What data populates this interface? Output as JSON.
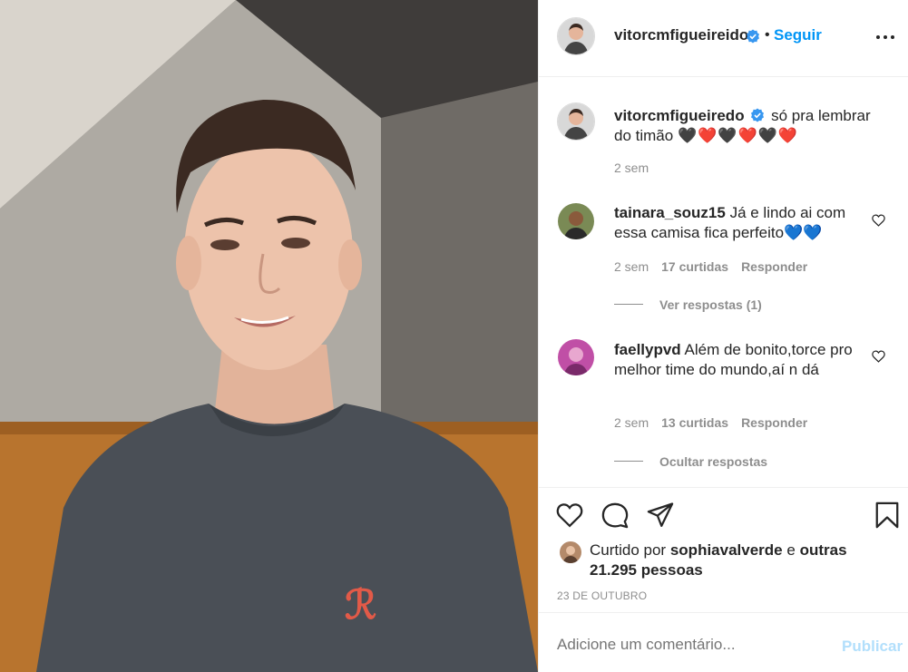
{
  "post": {
    "author": "vitorcmfigueireido",
    "dot": "•",
    "follow_label": "Seguir",
    "more_icon": "more-horizontal-icon",
    "caption": {
      "author": "vitorcmfigueiredo",
      "text": "só pra lembrar do timão",
      "hearts": "🖤❤️🖤❤️🖤❤️",
      "time": "2 sem"
    },
    "comments": [
      {
        "author": "tainara_souz15",
        "text": "Já e lindo ai com essa camisa fica perfeito",
        "emoji": "💙💙",
        "time": "2 sem",
        "likes": "17 curtidas",
        "reply_label": "Responder",
        "replies_toggle": "Ver respostas (1)"
      },
      {
        "author": "faellypvd",
        "text": "Além de bonito,torce pro melhor time do mundo,aí n dá",
        "time": "2 sem",
        "likes": "13 curtidas",
        "reply_label": "Responder",
        "replies_toggle": "Ocultar respostas"
      }
    ],
    "likes": {
      "prefix": "Curtido por",
      "user": "sophiavalverde",
      "conj": "e",
      "others": "outras 21.295 pessoas"
    },
    "date": "23 DE OUTUBRO",
    "comment_input": {
      "placeholder": "Adicione um comentário..."
    },
    "publish_label": "Publicar"
  },
  "colors": {
    "accent": "#0095f6",
    "publish_disabled": "#b2dffc",
    "muted": "#8e8e8e",
    "text": "#262626",
    "verified": "#3897f0"
  }
}
